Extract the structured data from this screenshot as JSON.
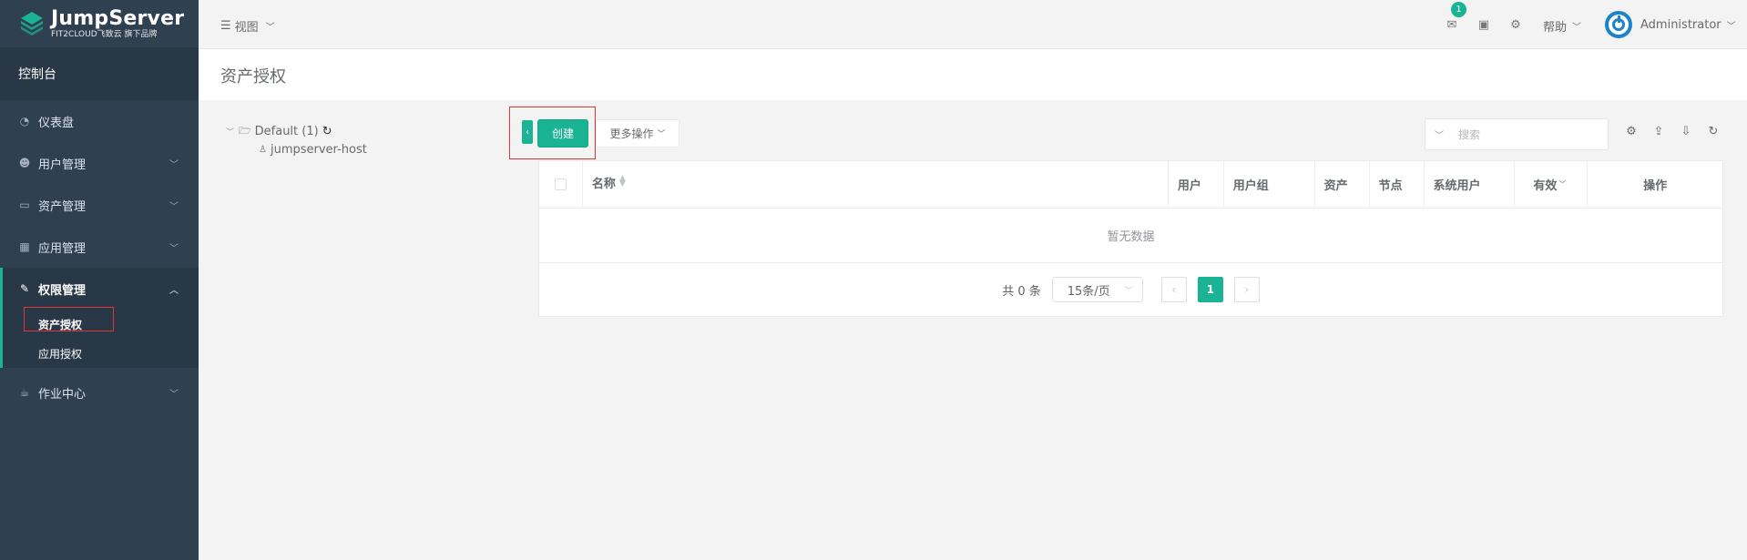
{
  "brand": {
    "name": "JumpServer",
    "subtitle": "FIT2CLOUD飞致云 旗下品牌"
  },
  "sidebar": {
    "console": "控制台",
    "items": [
      {
        "label": "仪表盘",
        "icon": "dashboard-icon"
      },
      {
        "label": "用户管理",
        "icon": "users-icon"
      },
      {
        "label": "资产管理",
        "icon": "inbox-icon"
      },
      {
        "label": "应用管理",
        "icon": "grid-icon"
      },
      {
        "label": "权限管理",
        "icon": "edit-icon"
      },
      {
        "label": "作业中心",
        "icon": "coffee-icon"
      }
    ],
    "perm_sub": [
      {
        "label": "资产授权"
      },
      {
        "label": "应用授权"
      }
    ]
  },
  "header": {
    "view_menu": "视图",
    "mail_badge": "1",
    "help": "帮助",
    "user": "Administrator"
  },
  "page": {
    "title": "资产授权"
  },
  "tree": {
    "root": "Default (1)",
    "child": "jumpserver-host"
  },
  "toolbar": {
    "create": "创建",
    "more": "更多操作",
    "search_placeholder": "搜索"
  },
  "table": {
    "columns": [
      "名称",
      "用户",
      "用户组",
      "资产",
      "节点",
      "系统用户",
      "有效",
      "操作"
    ],
    "empty": "暂无数据"
  },
  "pagination": {
    "total": "共 0 条",
    "page_size": "15条/页",
    "current": "1"
  },
  "colors": {
    "accent": "#1ab394",
    "sidebar": "#2f4050",
    "highlight": "#e0363a"
  }
}
